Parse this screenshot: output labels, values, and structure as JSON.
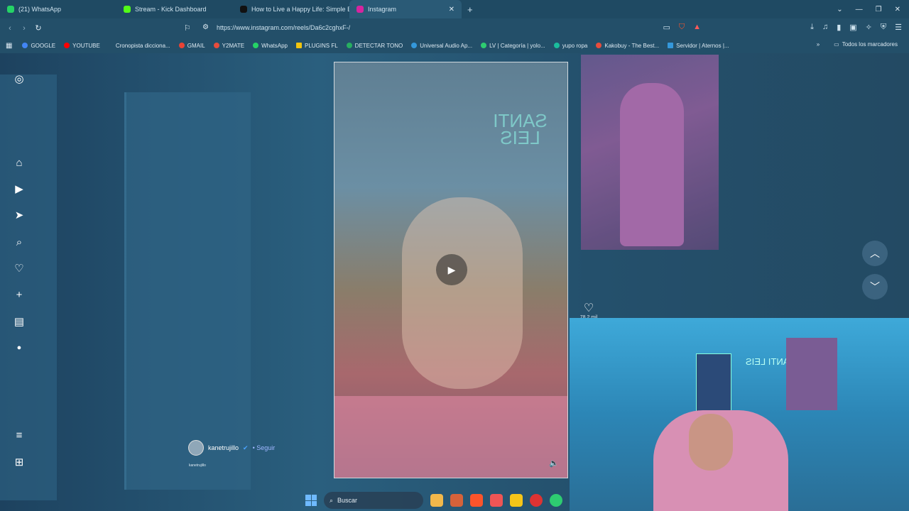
{
  "browser": {
    "tabs": [
      {
        "label": "(21) WhatsApp",
        "color": "#25d366"
      },
      {
        "label": "Stream - Kick Dashboard",
        "color": "#53fc18"
      },
      {
        "label": "How to Live a Happy Life: Simple Eve",
        "color": "#111111"
      },
      {
        "label": "Instagram",
        "color": "#d6249f",
        "active": true
      }
    ],
    "new_tab": "+",
    "url": "https://www.instagram.com/reels/Da6c2cghxF-/",
    "bookmarks": [
      {
        "label": "GOOGLE",
        "color": "#4285f4"
      },
      {
        "label": "YOUTUBE",
        "color": "#ff0000"
      },
      {
        "label": "Cronopista dicciona...",
        "color": "#888888"
      },
      {
        "label": "GMAIL",
        "color": "#ea4335"
      },
      {
        "label": "Y2MATE",
        "color": "#e74c3c"
      },
      {
        "label": "WhatsApp",
        "color": "#25d366"
      },
      {
        "label": "PLUGINS FL",
        "color": "#f1c40f"
      },
      {
        "label": "DETECTAR TONO",
        "color": "#27ae60"
      },
      {
        "label": "Universal Audio Ap...",
        "color": "#3498db"
      },
      {
        "label": "LV | Categoría | yolo...",
        "color": "#2ecc71"
      },
      {
        "label": "yupo ropa",
        "color": "#1abc9c"
      },
      {
        "label": "Kakobuy - The Best...",
        "color": "#e74c3c"
      },
      {
        "label": "Servidor | Aternos |...",
        "color": "#3498db"
      }
    ],
    "bookmarks_all": "Todos los marcadores"
  },
  "instagram": {
    "reel": {
      "neon_text": "SANTI LEIS",
      "likes": "78,2 mil",
      "author": "kanetrujillo",
      "follow": "• Seguir",
      "author_sub": "kanetrujillo"
    }
  },
  "webcam": {
    "neon_text": "SANTI LEIS"
  },
  "taskbar": {
    "search_placeholder": "Buscar"
  }
}
